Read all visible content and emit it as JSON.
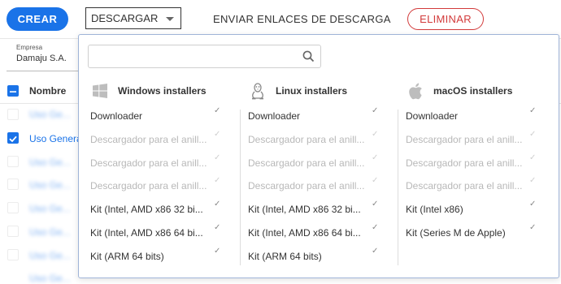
{
  "toolbar": {
    "crear_label": "CREAR",
    "descargar_label": "DESCARGAR",
    "enviar_label": "ENVIAR ENLACES DE DESCARGA",
    "eliminar_label": "ELIMINAR"
  },
  "filter": {
    "empresa_label": "Empresa",
    "empresa_value": "Damaju S.A."
  },
  "table": {
    "header": "Nombre",
    "visible_row": "Uso General"
  },
  "colors": {
    "primary": "#1a73e8",
    "danger": "#d23a3a"
  },
  "download_panel": {
    "search_placeholder": "",
    "columns": [
      {
        "title": "Windows installers",
        "icon": "windows-icon",
        "items": [
          {
            "label": "Downloader",
            "enabled": true
          },
          {
            "label": "Descargador para el anill...",
            "enabled": false
          },
          {
            "label": "Descargador para el anill...",
            "enabled": false
          },
          {
            "label": "Descargador para el anill...",
            "enabled": false
          },
          {
            "label": "Kit (Intel, AMD x86 32 bi...",
            "enabled": true
          },
          {
            "label": "Kit (Intel, AMD x86 64 bi...",
            "enabled": true
          },
          {
            "label": "Kit (ARM 64 bits)",
            "enabled": true
          }
        ]
      },
      {
        "title": "Linux installers",
        "icon": "linux-icon",
        "items": [
          {
            "label": "Downloader",
            "enabled": true
          },
          {
            "label": "Descargador para el anill...",
            "enabled": false
          },
          {
            "label": "Descargador para el anill...",
            "enabled": false
          },
          {
            "label": "Descargador para el anill...",
            "enabled": false
          },
          {
            "label": "Kit (Intel, AMD x86 32 bi...",
            "enabled": true
          },
          {
            "label": "Kit (Intel, AMD x86 64 bi...",
            "enabled": true
          },
          {
            "label": "Kit (ARM 64 bits)",
            "enabled": true
          }
        ]
      },
      {
        "title": "macOS installers",
        "icon": "apple-icon",
        "items": [
          {
            "label": "Downloader",
            "enabled": true
          },
          {
            "label": "Descargador para el anill...",
            "enabled": false
          },
          {
            "label": "Descargador para el anill...",
            "enabled": false
          },
          {
            "label": "Descargador para el anill...",
            "enabled": false
          },
          {
            "label": "Kit (Intel x86)",
            "enabled": true
          },
          {
            "label": "Kit (Series M de Apple)",
            "enabled": true
          }
        ]
      }
    ]
  }
}
